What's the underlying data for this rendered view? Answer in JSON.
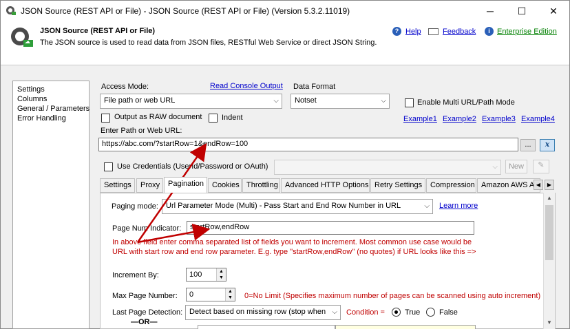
{
  "window": {
    "title": "JSON Source (REST API or File) - JSON Source (REST API or File) (Version 5.3.2.11019)",
    "minimize": "─",
    "maximize": "☐",
    "close": "✕"
  },
  "header": {
    "title": "JSON Source (REST API or File)",
    "description": "The JSON source is used to read data from JSON files, RESTful Web Service or direct JSON String.",
    "help": "Help",
    "feedback": "Feedback",
    "enterprise": "Enterprise Edition"
  },
  "sidebar": {
    "items": [
      {
        "label": "Settings"
      },
      {
        "label": "Columns"
      },
      {
        "label": "General / Parameters"
      },
      {
        "label": "Error Handling"
      }
    ]
  },
  "settings": {
    "access_mode_label": "Access Mode:",
    "read_console_output": "Read Console Output",
    "access_mode_value": "File path or web URL",
    "data_format_label": "Data Format",
    "data_format_value": "Notset",
    "enable_multi_url": "Enable Multi URL/Path Mode",
    "output_raw": "Output as RAW document",
    "indent": "Indent",
    "examples": [
      "Example1",
      "Example2",
      "Example3",
      "Example4"
    ],
    "path_label": "Enter Path or Web URL:",
    "path_value": "https://abc.com/?startRow=1&endRow=100",
    "browse": "...",
    "use_credentials": "Use Credentials (UserId/Password or OAuth)",
    "new_button": "New"
  },
  "tabs": [
    {
      "label": "Settings"
    },
    {
      "label": "Proxy"
    },
    {
      "label": "Pagination"
    },
    {
      "label": "Cookies"
    },
    {
      "label": "Throttling"
    },
    {
      "label": "Advanced HTTP Options"
    },
    {
      "label": "Retry Settings"
    },
    {
      "label": "Compression"
    },
    {
      "label": "Amazon AWS A"
    }
  ],
  "pagination": {
    "paging_mode_label": "Paging mode:",
    "paging_mode_value": "Url Parameter Mode (Multi) - Pass Start and End Row Number in URL",
    "learn_more": "Learn more",
    "page_num_label": "Page Num Indicator:",
    "page_num_value": "startRow,endRow",
    "help_line1": "In above field enter comma separated list of fields you want to increment. Most common use case would be",
    "help_line2": "URL with start row and end row parameter. E.g. type \"startRow,endRow\" (no quotes) if URL looks like this =>",
    "increment_label": "Increment By:",
    "increment_value": "100",
    "max_page_label": "Max Page Number:",
    "max_page_value": "0",
    "max_page_note": "0=No Limit (Specifies maximum number of pages can be scanned using auto increment)",
    "last_page_label": "Last Page Detection:",
    "last_page_value": "Detect based on missing row (stop when",
    "condition_label": "Condition =",
    "true_label": "True",
    "false_label": "False",
    "or_label": "—OR—"
  }
}
